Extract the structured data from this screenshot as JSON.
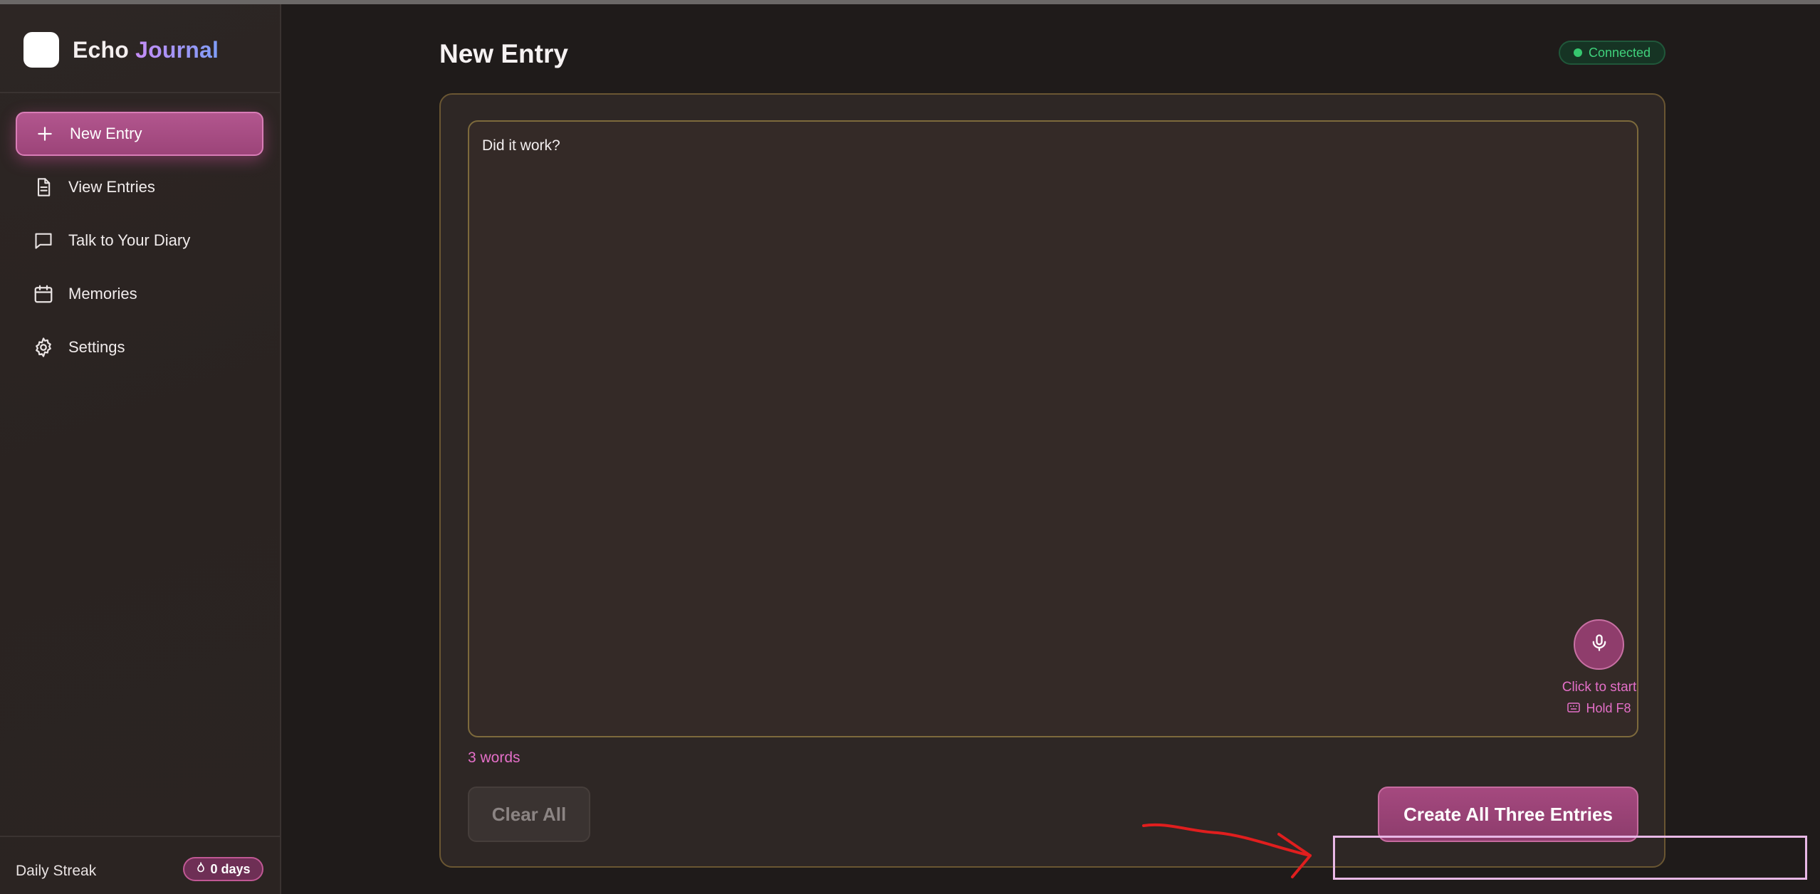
{
  "app": {
    "brand_part1": "Echo",
    "brand_part2": "Journal"
  },
  "sidebar": {
    "items": [
      {
        "label": "New Entry",
        "icon": "plus-icon",
        "active": true
      },
      {
        "label": "View Entries",
        "icon": "document-icon",
        "active": false
      },
      {
        "label": "Talk to Your Diary",
        "icon": "chat-bubble-icon",
        "active": false
      },
      {
        "label": "Memories",
        "icon": "calendar-icon",
        "active": false
      },
      {
        "label": "Settings",
        "icon": "gear-icon",
        "active": false
      }
    ],
    "streak_label": "Daily Streak",
    "streak_value": "0 days",
    "streak_icon": "flame-icon"
  },
  "header": {
    "title": "New Entry",
    "status": "Connected"
  },
  "editor": {
    "value": "Did it work?",
    "mic_hint": "Click to start",
    "hotkey_hint": "Hold F8",
    "hotkey_icon": "keyboard-icon",
    "mic_icon": "microphone-icon",
    "word_count": "3 words"
  },
  "actions": {
    "clear_label": "Clear All",
    "create_label": "Create All Three Entries"
  },
  "colors": {
    "accent": "#a5497f",
    "status_green": "#40d27c",
    "annotation_red": "#e01e1e",
    "annotation_box": "#e8b8e6"
  }
}
